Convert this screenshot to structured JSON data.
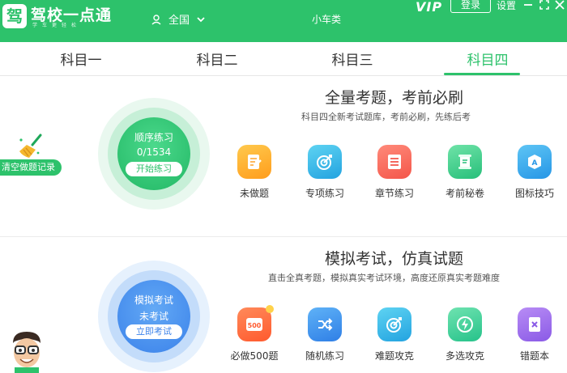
{
  "header": {
    "logo_char": "驾",
    "app_name": "驾校一点通",
    "slogan": "学车更轻松",
    "region": "全国",
    "vehicle": "小车类",
    "vip": "VIP",
    "login": "登录",
    "settings": "设置"
  },
  "tabs": [
    {
      "label": "科目一"
    },
    {
      "label": "科目二"
    },
    {
      "label": "科目三"
    },
    {
      "label": "科目四"
    }
  ],
  "active_tab": "科目四",
  "clear_records": "清空做题记录",
  "practice": {
    "title": "全量考题，考前必刷",
    "subtitle": "科目四全新考试题库，考前必刷，先练后考",
    "circle": {
      "title": "顺序练习",
      "progress": "0/1534",
      "button": "开始练习"
    },
    "features": [
      {
        "label": "未做题",
        "icon": "unanswered-icon"
      },
      {
        "label": "专项练习",
        "icon": "target-icon"
      },
      {
        "label": "章节练习",
        "icon": "list-icon"
      },
      {
        "label": "考前秘卷",
        "icon": "scroll-icon"
      },
      {
        "label": "图标技巧",
        "icon": "sign-icon"
      }
    ]
  },
  "exam": {
    "title": "模拟考试，仿真试题",
    "subtitle": "直击全真考题，模拟真实考试环境，高度还原真实考题难度",
    "circle": {
      "title": "模拟考试",
      "status": "未考试",
      "button": "立即考试"
    },
    "features": [
      {
        "label": "必做500题",
        "icon": "must-500-icon",
        "badge": "500"
      },
      {
        "label": "随机练习",
        "icon": "shuffle-icon"
      },
      {
        "label": "难题攻克",
        "icon": "target-icon"
      },
      {
        "label": "多选攻克",
        "icon": "lightning-icon"
      },
      {
        "label": "错题本",
        "icon": "wrong-book-icon"
      }
    ]
  },
  "colors": {
    "brand": "#2dc26b",
    "exam_blue": "#3b82ea"
  }
}
